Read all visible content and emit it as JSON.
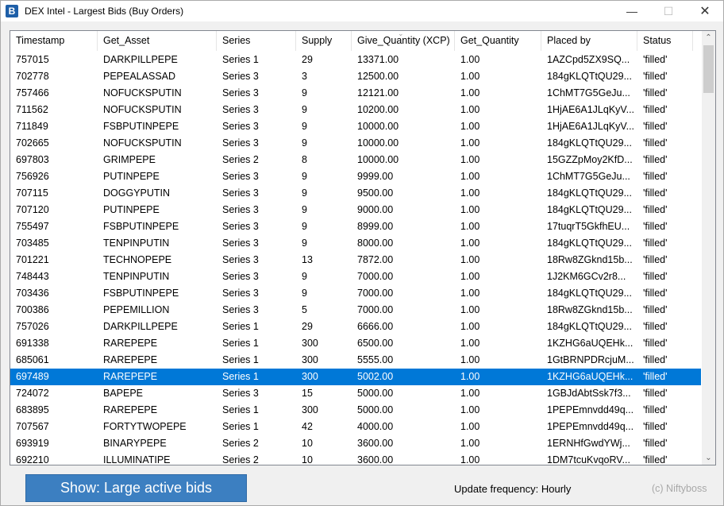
{
  "window": {
    "app_icon": "B",
    "title": "DEX Intel - Largest Bids (Buy Orders)",
    "min_glyph": "—",
    "max_glyph": "☐",
    "close_glyph": "✕"
  },
  "table": {
    "columns": [
      "Timestamp",
      "Get_Asset",
      "Series",
      "Supply",
      "Give_Quantity (XCP)",
      "Get_Quantity",
      "Placed by",
      "Status"
    ],
    "sort_glyph": "⌄",
    "selected_row_index": 19,
    "rows": [
      [
        "757015",
        "DARKPILLPEPE",
        "Series 1",
        "29",
        "13371.00",
        "1.00",
        "1AZCpd5ZX9SQ...",
        "'filled'"
      ],
      [
        "702778",
        "PEPEALASSAD",
        "Series 3",
        "3",
        "12500.00",
        "1.00",
        "184gKLQTtQU29...",
        "'filled'"
      ],
      [
        "757466",
        "NOFUCKSPUTIN",
        "Series 3",
        "9",
        "12121.00",
        "1.00",
        "1ChMT7G5GeJu...",
        "'filled'"
      ],
      [
        "711562",
        "NOFUCKSPUTIN",
        "Series 3",
        "9",
        "10200.00",
        "1.00",
        "1HjAE6A1JLqKyV...",
        "'filled'"
      ],
      [
        "711849",
        "FSBPUTINPEPE",
        "Series 3",
        "9",
        "10000.00",
        "1.00",
        "1HjAE6A1JLqKyV...",
        "'filled'"
      ],
      [
        "702665",
        "NOFUCKSPUTIN",
        "Series 3",
        "9",
        "10000.00",
        "1.00",
        "184gKLQTtQU29...",
        "'filled'"
      ],
      [
        "697803",
        "GRIMPEPE",
        "Series 2",
        "8",
        "10000.00",
        "1.00",
        "15GZZpMoy2KfD...",
        "'filled'"
      ],
      [
        "756926",
        "PUTINPEPE",
        "Series 3",
        "9",
        "9999.00",
        "1.00",
        "1ChMT7G5GeJu...",
        "'filled'"
      ],
      [
        "707115",
        "DOGGYPUTIN",
        "Series 3",
        "9",
        "9500.00",
        "1.00",
        "184gKLQTtQU29...",
        "'filled'"
      ],
      [
        "707120",
        "PUTINPEPE",
        "Series 3",
        "9",
        "9000.00",
        "1.00",
        "184gKLQTtQU29...",
        "'filled'"
      ],
      [
        "755497",
        "FSBPUTINPEPE",
        "Series 3",
        "9",
        "8999.00",
        "1.00",
        "17tuqrT5GkfhEU...",
        "'filled'"
      ],
      [
        "703485",
        "TENPINPUTIN",
        "Series 3",
        "9",
        "8000.00",
        "1.00",
        "184gKLQTtQU29...",
        "'filled'"
      ],
      [
        "701221",
        "TECHNOPEPE",
        "Series 3",
        "13",
        "7872.00",
        "1.00",
        "18Rw8ZGknd15b...",
        "'filled'"
      ],
      [
        "748443",
        "TENPINPUTIN",
        "Series 3",
        "9",
        "7000.00",
        "1.00",
        "1J2KM6GCv2r8...",
        "'filled'"
      ],
      [
        "703436",
        "FSBPUTINPEPE",
        "Series 3",
        "9",
        "7000.00",
        "1.00",
        "184gKLQTtQU29...",
        "'filled'"
      ],
      [
        "700386",
        "PEPEMILLION",
        "Series 3",
        "5",
        "7000.00",
        "1.00",
        "18Rw8ZGknd15b...",
        "'filled'"
      ],
      [
        "757026",
        "DARKPILLPEPE",
        "Series 1",
        "29",
        "6666.00",
        "1.00",
        "184gKLQTtQU29...",
        "'filled'"
      ],
      [
        "691338",
        "RAREPEPE",
        "Series 1",
        "300",
        "6500.00",
        "1.00",
        "1KZHG6aUQEHk...",
        "'filled'"
      ],
      [
        "685061",
        "RAREPEPE",
        "Series 1",
        "300",
        "5555.00",
        "1.00",
        "1GtBRNPDRcjuM...",
        "'filled'"
      ],
      [
        "697489",
        "RAREPEPE",
        "Series 1",
        "300",
        "5002.00",
        "1.00",
        "1KZHG6aUQEHk...",
        "'filled'"
      ],
      [
        "724072",
        "BAPEPE",
        "Series 3",
        "15",
        "5000.00",
        "1.00",
        "1GBJdAbtSsk7f3...",
        "'filled'"
      ],
      [
        "683895",
        "RAREPEPE",
        "Series 1",
        "300",
        "5000.00",
        "1.00",
        "1PEPEmnvdd49q...",
        "'filled'"
      ],
      [
        "707567",
        "FORTYTWOPEPE",
        "Series 1",
        "42",
        "4000.00",
        "1.00",
        "1PEPEmnvdd49q...",
        "'filled'"
      ],
      [
        "693919",
        "BINARYPEPE",
        "Series 2",
        "10",
        "3600.00",
        "1.00",
        "1ERNHfGwdYWj...",
        "'filled'"
      ],
      [
        "692210",
        "ILLUMINATIPE",
        "Series 2",
        "10",
        "3600.00",
        "1.00",
        "1DM7tcuKvqoRV...",
        "'filled'"
      ]
    ]
  },
  "scrollbar": {
    "up_glyph": "⌃",
    "down_glyph": "⌄"
  },
  "footer": {
    "show_button_label": "Show: Large active bids",
    "update_frequency": "Update frequency: Hourly",
    "copyright": "(c) Niftyboss"
  }
}
